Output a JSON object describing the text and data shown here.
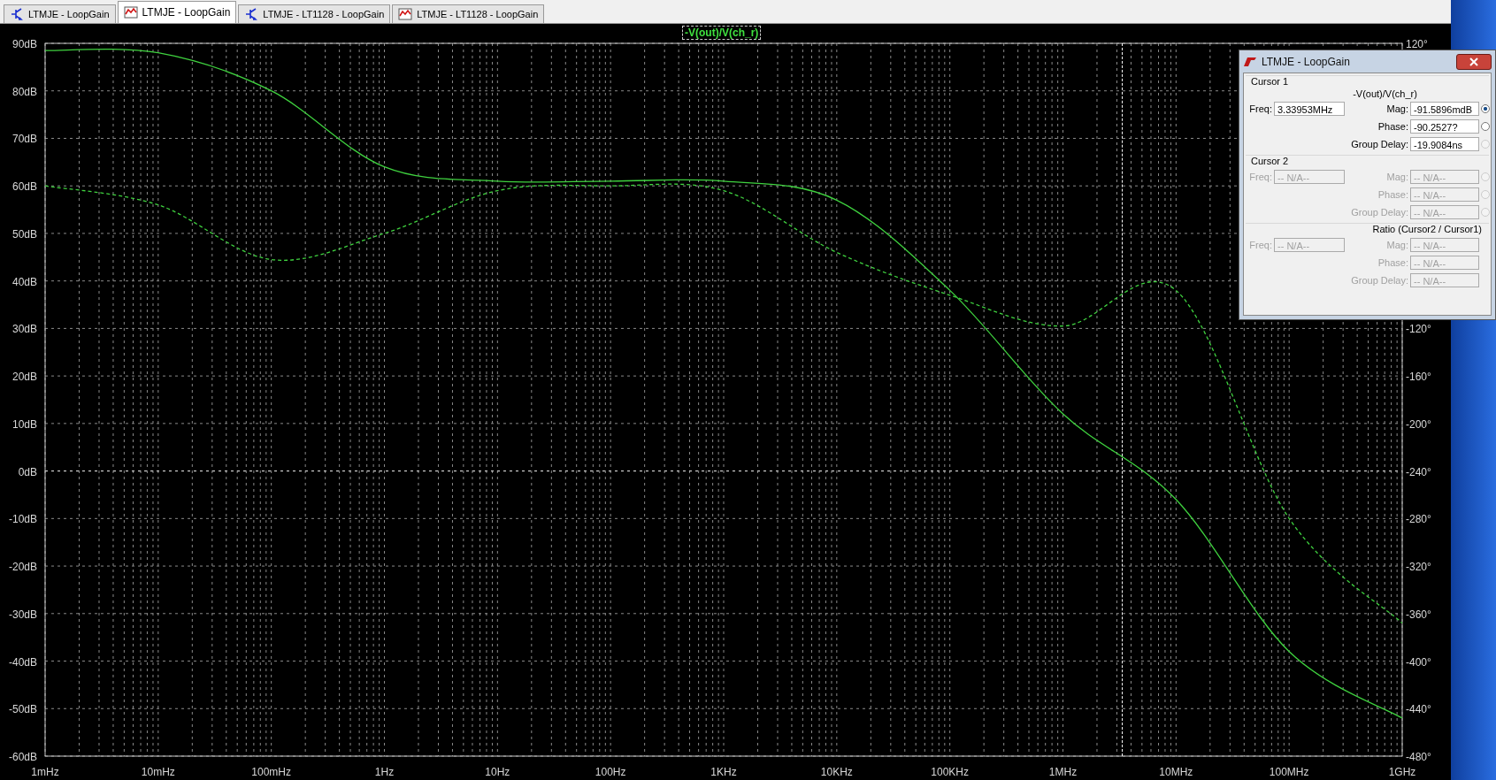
{
  "tabs": [
    {
      "label": "LTMJE - LoopGain",
      "kind": "schematic",
      "selected": false
    },
    {
      "label": "LTMJE - LoopGain",
      "kind": "waveform",
      "selected": true
    },
    {
      "label": "LTMJE - LT1128 - LoopGain",
      "kind": "schematic",
      "selected": false
    },
    {
      "label": "LTMJE - LT1128 - LoopGain",
      "kind": "waveform",
      "selected": false
    }
  ],
  "plot": {
    "chart_data": {
      "type": "line",
      "categories": [
        "1mHz",
        "10mHz",
        "100mHz",
        "1Hz",
        "10Hz",
        "100Hz",
        "1KHz",
        "10KHz",
        "100KHz",
        "1MHz",
        "10MHz",
        "100MHz",
        "1GHz"
      ],
      "series": [
        {
          "name": "-V(out)/V(ch_r)",
          "color": "#3fd23f",
          "line_style": "solid",
          "values": [
            88.5,
            88,
            80,
            64,
            61,
            61,
            61,
            57,
            38,
            12,
            -6,
            -38,
            -52
          ]
        },
        {
          "color": "#3fd23f",
          "axis": "y2",
          "line_style": "dashed",
          "values": [
            0,
            -16,
            -62,
            -40,
            -4,
            0,
            -4,
            -56,
            -92,
            -118,
            -88,
            -280,
            -368
          ]
        }
      ],
      "ylim": [
        -60,
        90
      ],
      "y2lim": [
        -480,
        120
      ],
      "yticks": [
        {
          "value": 90,
          "label": "90dB"
        },
        {
          "value": 80,
          "label": "80dB"
        },
        {
          "value": 70,
          "label": "70dB"
        },
        {
          "value": 60,
          "label": "60dB"
        },
        {
          "value": 50,
          "label": "50dB"
        },
        {
          "value": 40,
          "label": "40dB"
        },
        {
          "value": 30,
          "label": "30dB"
        },
        {
          "value": 20,
          "label": "20dB"
        },
        {
          "value": 10,
          "label": "10dB"
        },
        {
          "value": 0,
          "label": "0dB"
        },
        {
          "value": -10,
          "label": "-10dB"
        },
        {
          "value": -20,
          "label": "-20dB"
        },
        {
          "value": -30,
          "label": "-30dB"
        },
        {
          "value": -40,
          "label": "-40dB"
        },
        {
          "value": -50,
          "label": "-50dB"
        },
        {
          "value": -60,
          "label": "-60dB"
        }
      ],
      "y2ticks": [
        {
          "value": 120,
          "label": "120°"
        },
        {
          "value": -120,
          "label": "-120°"
        },
        {
          "value": -160,
          "label": "-160°"
        },
        {
          "value": -200,
          "label": "-200°"
        },
        {
          "value": -240,
          "label": "-240°"
        },
        {
          "value": -280,
          "label": "-280°"
        },
        {
          "value": -320,
          "label": "-320°"
        },
        {
          "value": -360,
          "label": "-360°"
        },
        {
          "value": -400,
          "label": "-400°"
        },
        {
          "value": -440,
          "label": "-440°"
        },
        {
          "value": -480,
          "label": "-480°"
        }
      ],
      "grid": true,
      "ref_lines": [
        {
          "axis": "y",
          "value": 0
        }
      ]
    }
  },
  "cursor_dialog": {
    "title": "LTMJE - LoopGain",
    "groups": [
      {
        "heading": "Cursor 1",
        "trace": "-V(out)/V(ch_r)",
        "disabled": false,
        "freq": {
          "label": "Freq:",
          "value": "3.33953MHz"
        },
        "rows": [
          {
            "label": "Mag:",
            "value": "-91.5896mdB",
            "radio": {
              "selected": true,
              "disabled": false
            }
          },
          {
            "label": "Phase:",
            "value": "-90.2527?",
            "radio": {
              "selected": false,
              "disabled": false
            }
          },
          {
            "label": "Group Delay:",
            "value": "-19.9084ns",
            "radio": {
              "selected": false,
              "disabled": true
            }
          }
        ]
      },
      {
        "heading": "Cursor 2",
        "disabled": true,
        "freq": {
          "label": "Freq:",
          "value": "-- N/A--"
        },
        "rows": [
          {
            "label": "Mag:",
            "value": "-- N/A--",
            "radio": {
              "selected": false,
              "disabled": true
            }
          },
          {
            "label": "Phase:",
            "value": "-- N/A--",
            "radio": {
              "selected": false,
              "disabled": true
            }
          },
          {
            "label": "Group Delay:",
            "value": "-- N/A--",
            "radio": {
              "selected": false,
              "disabled": true
            }
          }
        ]
      },
      {
        "heading": "Ratio (Cursor2 / Cursor1)",
        "disabled": true,
        "freq": {
          "label": "Freq:",
          "value": "-- N/A--"
        },
        "rows": [
          {
            "label": "Mag:",
            "value": "-- N/A--"
          },
          {
            "label": "Phase:",
            "value": "-- N/A--"
          },
          {
            "label": "Group Delay:",
            "value": "-- N/A--"
          }
        ]
      }
    ]
  }
}
